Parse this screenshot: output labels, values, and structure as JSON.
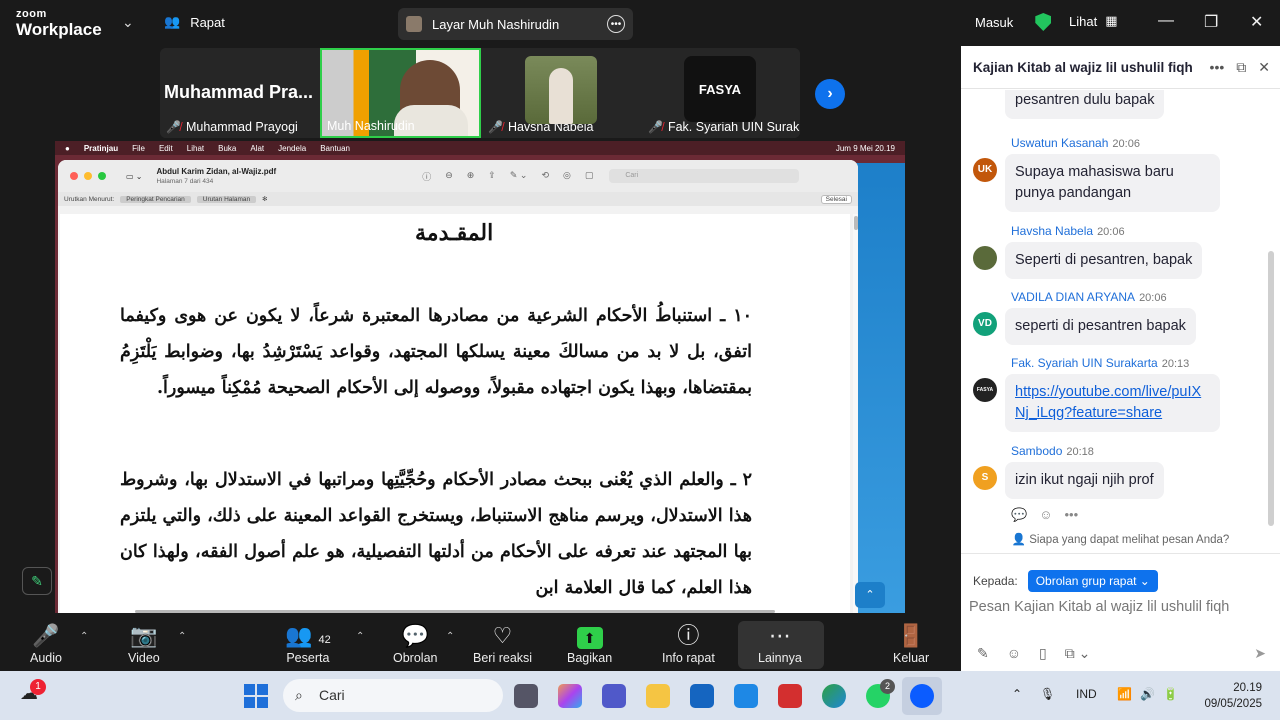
{
  "app": {
    "brand_small": "zoom",
    "brand_large": "Workplace",
    "meeting_menu": "Rapat",
    "sharing_label": "Layar Muh Nashirudin",
    "signin": "Masuk",
    "view": "Lihat"
  },
  "participants": [
    {
      "big": "Muhammad  Pra...",
      "name": "Muhammad Prayogi"
    },
    {
      "name": "Muh Nashirudin"
    },
    {
      "name": "Havsha Nabela"
    },
    {
      "name": "Fak. Syariah UIN Surak...",
      "logo": "FASYA"
    }
  ],
  "mac": {
    "menu": [
      "Pratinjau",
      "File",
      "Edit",
      "Lihat",
      "Buka",
      "Alat",
      "Jendela",
      "Bantuan"
    ],
    "clock": "Jum 9 Mei  20.19",
    "doc_title": "Abdul Karim Zidan, al-Wajiz.pdf",
    "doc_page": "Halaman 7 dari 434",
    "search_placeholder": "Cari",
    "sort_label": "Urutkan Menurut:",
    "sort_a": "Peringkat Pencarian",
    "sort_b": "Urutan Halaman",
    "done": "Selesai"
  },
  "document": {
    "heading": "المقـدمة",
    "para1": "١٠ ـ استنباطُ الأحكام الشرعية من مصادرها المعتبرة شرعاً، لا يكون عن هوى وكيفما اتفق، بل لا بد من مسالكَ معينة يسلكها المجتهد، وقواعد يَسْتَرْشِدُ بها، وضوابط يَلْتَزِمُ بمقتضاها، وبهذا يكون اجتهاده مقبولاً، ووصوله إلى الأحكام الصحيحة مُمْكِناً ميسوراً.",
    "para2": "٢ ـ والعلم الذي يُعْنى ببحث مصادر الأحكام وحُجِّيَّتِها ومراتبها في الاستدلال بها، وشروط هذا الاستدلال، ويرسم مناهج الاستنباط، ويستخرج القواعد المعينة على ذلك، والتي يلتزم بها المجتهد عند تعرفه على الأحكام من أدلتها التفصيلية، هو علم أصول الفقه، ولهذا كان هذا العلم، كما قال العلامة ابن"
  },
  "chat": {
    "title": "Kajian Kitab al wajiz lil ushulil fiqh",
    "messages": [
      {
        "text": "pesantren dulu bapak"
      },
      {
        "initials": "UK",
        "color": "#c2570b",
        "sender": "Uswatun Kasanah",
        "time": "20:06",
        "text": "Supaya mahasiswa baru punya pandangan"
      },
      {
        "initials": "",
        "color": "#5a6a3a",
        "sender": "Havsha Nabela",
        "time": "20:06",
        "text": "Seperti di pesantren, bapak"
      },
      {
        "initials": "VD",
        "color": "#12a17a",
        "sender": "VADILA DIAN ARYANA",
        "time": "20:06",
        "text": "seperti di pesantren bapak"
      },
      {
        "initials": "FASYA",
        "color": "#222222",
        "sender": "Fak. Syariah UIN Surakarta",
        "time": "20:13",
        "link": "https://youtube.com/live/puIXNj_iLqg?feature=share"
      },
      {
        "initials": "S",
        "color": "#f0a020",
        "sender": "Sambodo",
        "time": "20:18",
        "text": "izin ikut ngaji njih prof"
      }
    ],
    "who_can_see": "Siapa yang dapat melihat pesan Anda?",
    "to_label": "Kepada:",
    "to_value": "Obrolan grup rapat",
    "input_placeholder": "Pesan Kajian Kitab al wajiz lil ushulil fiqh"
  },
  "controls": {
    "audio": "Audio",
    "video": "Video",
    "participants": "Peserta",
    "participant_count": "42",
    "chat": "Obrolan",
    "reactions": "Beri reaksi",
    "share": "Bagikan",
    "info": "Info rapat",
    "more": "Lainnya",
    "leave": "Keluar"
  },
  "taskbar": {
    "search": "Cari",
    "lang": "IND",
    "time": "20.19",
    "date": "09/05/2025",
    "notif_badge": "1",
    "whatsapp_badge": "2"
  }
}
